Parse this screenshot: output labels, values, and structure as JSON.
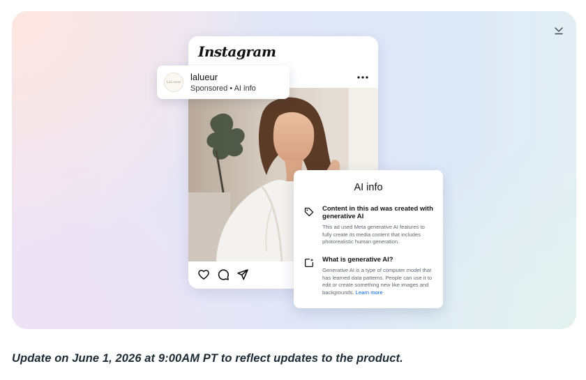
{
  "hero": {
    "instagram_card": {
      "logo_text": "Instagram",
      "menu_icon": "more-horizontal-icon",
      "action_icons": [
        "heart-icon",
        "comment-icon",
        "share-icon"
      ]
    },
    "profile": {
      "avatar_text": "LaLueur",
      "name": "lalueur",
      "subtitle": "Sponsored • AI info"
    },
    "ai_info": {
      "title": "AI info",
      "sections": [
        {
          "icon": "tag-icon",
          "heading": "Content in this ad was created with generative AI",
          "body": "This ad used Meta generative AI features to fully create its media content that includes photorealistic human generation."
        },
        {
          "icon": "sparkle-square-icon",
          "heading": "What is generative AI?",
          "body": "Generative AI is a type of computer model that has learned data patterns. People can use it to edit or create something new like images and backgrounds.",
          "link": "Learn more"
        }
      ]
    },
    "collapse_icon": "chevron-down-icon"
  },
  "update_note": "Update on June 1, 2026 at 9:00AM PT to reflect updates to the product.",
  "colors": {
    "text": "#1c2b33",
    "link": "#0064e0",
    "card_bg": "#ffffff"
  }
}
